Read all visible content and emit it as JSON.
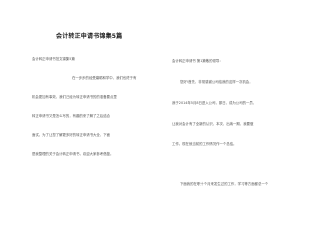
{
  "document": {
    "title": "会计转正申请书锦集5篇",
    "left_column": {
      "heading": "会计转正申请书范文锦集5篇",
      "lines": [
        "在一步步的经受磨砺和学中，我们也终于有",
        "机会更加有事效，我们己经为转正申请书的的准备要点里",
        "转正申请书又是怎么写的，有趣的来了解了之后结合",
        "面试。为了让您了解更多好的转正申请书大全，下面",
        "是我整理的关于会计转正申请书，欢迎大家参考借鉴。"
      ]
    },
    "right_column": {
      "heading": "会计转正申请书 第1篇敬的领导：",
      "lines": [
        "您好!首先，非常感谢公司给我的这样一次机会，",
        "我于2014年5月8日进入公司，那日，成为公司的一员，",
        "让我对会计有了全新的认识，本次，出纳一期，我要做",
        "工作。现在就当前的工作情况作一个总结。",
        "下面我的在职十个月来发生过的工作，学习等方面都总一个"
      ]
    }
  }
}
